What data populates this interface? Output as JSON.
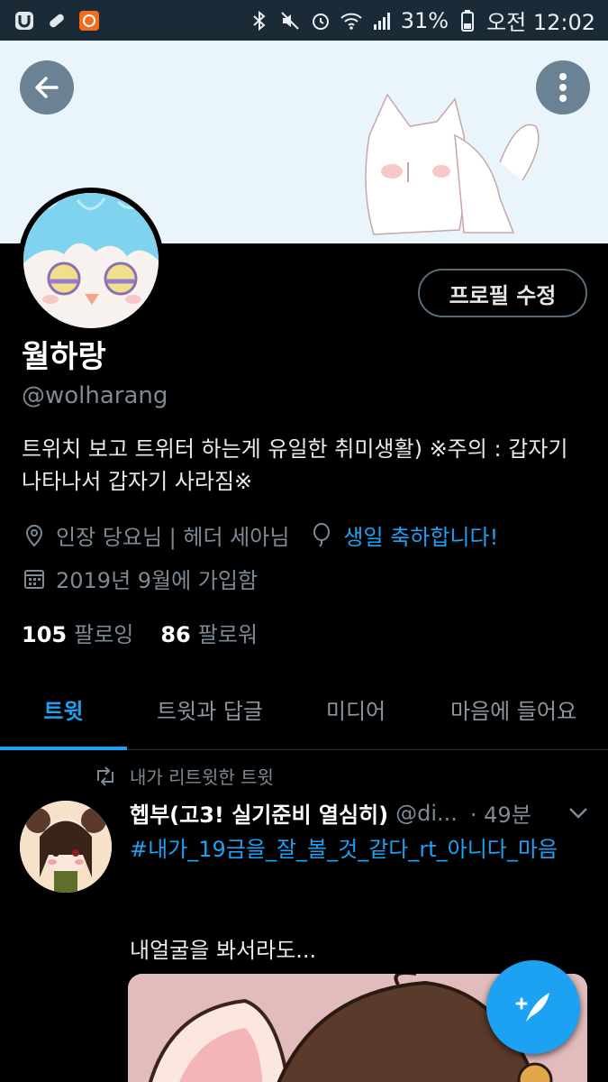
{
  "status_bar": {
    "battery": "31%",
    "time": "오전 12:02"
  },
  "profile": {
    "edit_button": "프로필 수정",
    "display_name": "월하랑",
    "handle": "@wolharang",
    "bio": "트위치 보고 트위터 하는게 유일한 취미생활)  ※주의 : 갑자기 나타나서 갑자기 사라짐※",
    "location": "인장 당요님 | 헤더 세아님",
    "birthday": "생일 축하합니다!",
    "joined": "2019년 9월에 가입함",
    "following_count": "105",
    "following_label": "팔로잉",
    "followers_count": "86",
    "followers_label": "팔로워"
  },
  "tabs": [
    {
      "label": "트윗",
      "active": true
    },
    {
      "label": "트윗과 답글",
      "active": false
    },
    {
      "label": "미디어",
      "active": false
    },
    {
      "label": "마음에 들어요",
      "active": false
    }
  ],
  "tweet": {
    "retweet_label": "내가 리트윗한 트윗",
    "author_name": "헵부(고3! 실기준비 열심히)",
    "author_handle": "@di...",
    "time": "· 49분",
    "hashtag": "#내가_19금을_잘_볼_것_같다_rt_아니다_마음",
    "text": "내얼굴을 봐서라도..."
  },
  "colors": {
    "accent": "#1da1f2",
    "background": "#000000",
    "muted": "#7c8a95",
    "banner": "#e9f4fb"
  },
  "icons": [
    "back-arrow-icon",
    "more-vertical-icon",
    "location-pin-icon",
    "balloon-icon",
    "calendar-icon",
    "retweet-icon",
    "chevron-down-icon",
    "compose-feather-icon"
  ]
}
